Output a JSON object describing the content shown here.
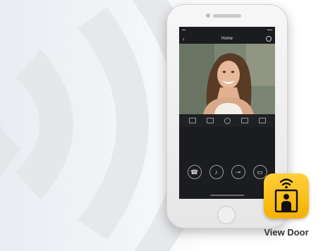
{
  "app_icon": {
    "label": "View Door",
    "icon": "intercom-video-icon",
    "color": "#f9b800"
  },
  "phone": {
    "nav_title": "Home",
    "video_controls": [
      "mute-icon",
      "snapshot-icon",
      "record-icon",
      "camera-switch-icon",
      "fullscreen-icon"
    ],
    "action_buttons": [
      "call-icon",
      "mic-icon",
      "unlock-icon",
      "gallery-icon"
    ]
  },
  "decor": {
    "wave_color": "#e7e9ec"
  }
}
